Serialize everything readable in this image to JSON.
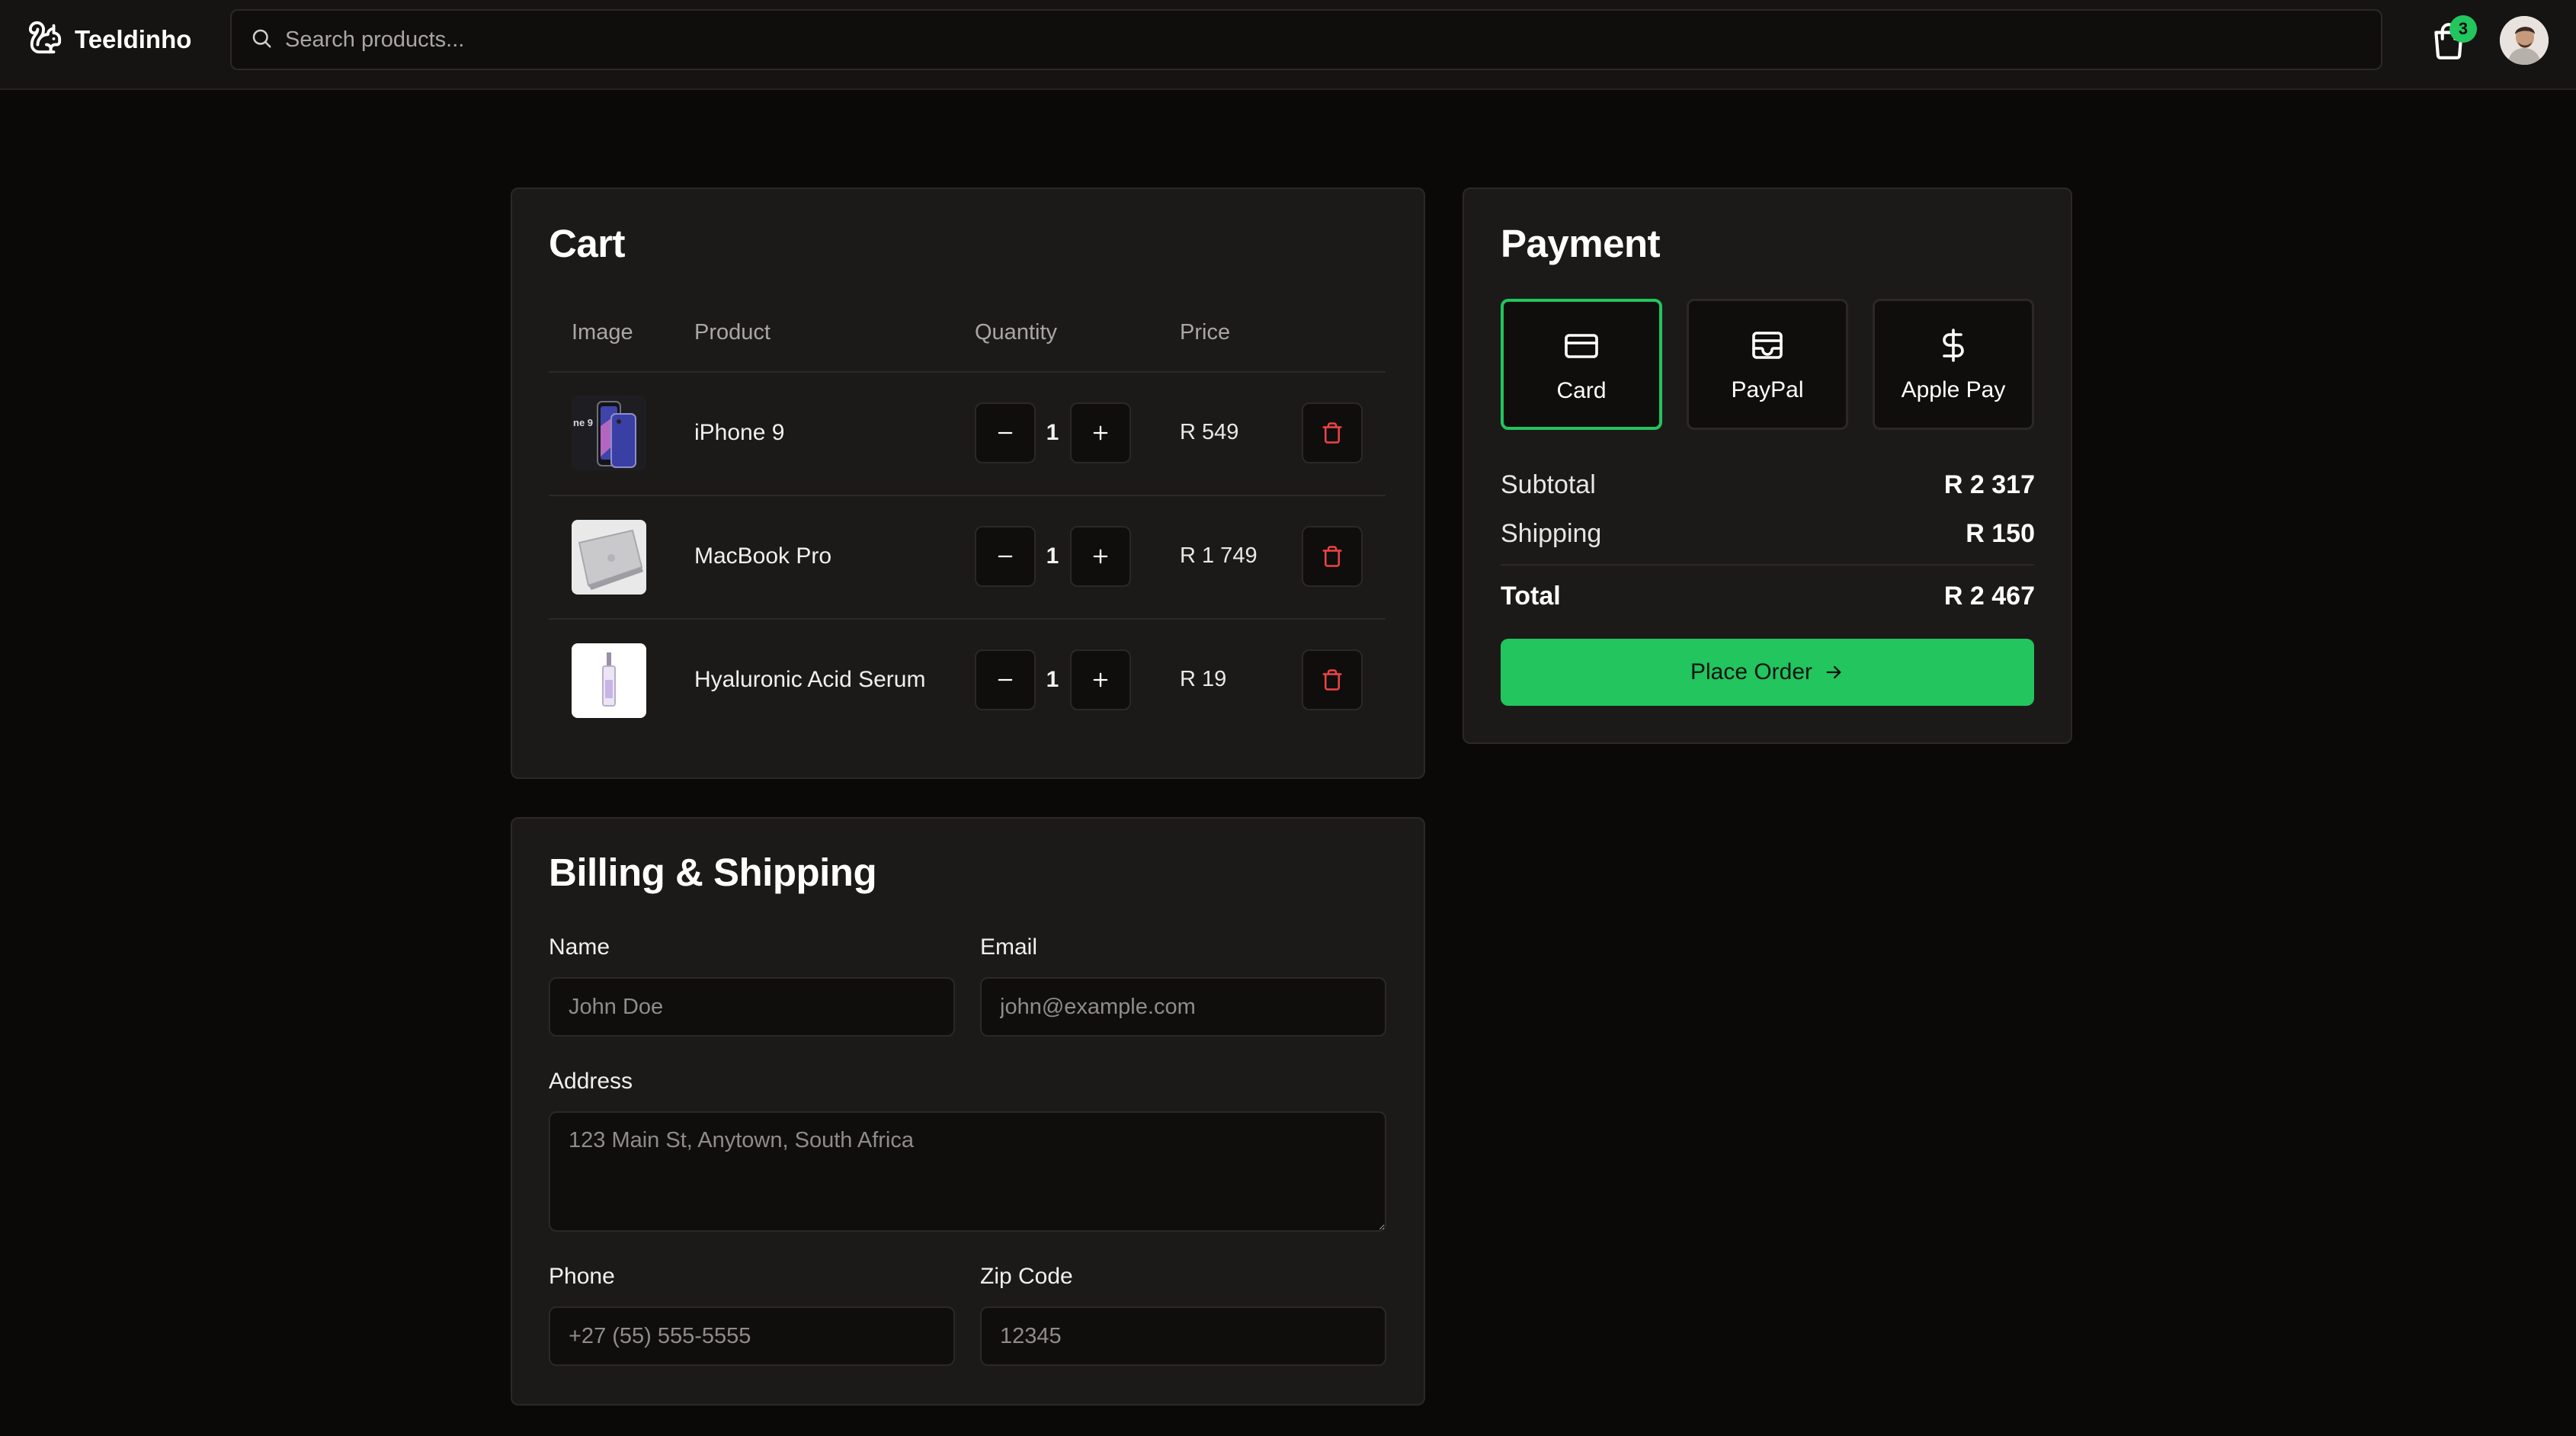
{
  "app": {
    "name": "Teeldinho"
  },
  "search": {
    "placeholder": "Search products..."
  },
  "header": {
    "cart_count": "3"
  },
  "cart": {
    "title": "Cart",
    "columns": [
      "Image",
      "Product",
      "Quantity",
      "Price"
    ],
    "items": [
      {
        "name": "iPhone 9",
        "quantity": "1",
        "price": "R 549"
      },
      {
        "name": "MacBook Pro",
        "quantity": "1",
        "price": "R 1 749"
      },
      {
        "name": "Hyaluronic Acid Serum",
        "quantity": "1",
        "price": "R 19"
      }
    ]
  },
  "billing": {
    "title": "Billing & Shipping",
    "name_label": "Name",
    "name_placeholder": "John Doe",
    "email_label": "Email",
    "email_placeholder": "john@example.com",
    "address_label": "Address",
    "address_placeholder": "123 Main St, Anytown, South Africa",
    "phone_label": "Phone",
    "phone_placeholder": "+27 (55) 555-5555",
    "zip_label": "Zip Code",
    "zip_placeholder": "12345"
  },
  "payment": {
    "title": "Payment",
    "methods": [
      {
        "label": "Card",
        "icon": "credit-card-icon",
        "selected": true
      },
      {
        "label": "PayPal",
        "icon": "wallet-icon",
        "selected": false
      },
      {
        "label": "Apple Pay",
        "icon": "dollar-icon",
        "selected": false
      }
    ],
    "subtotal_label": "Subtotal",
    "subtotal": "R 2 317",
    "shipping_label": "Shipping",
    "shipping": "R 150",
    "total_label": "Total",
    "total": "R 2 467",
    "place_order_label": "Place Order"
  },
  "colors": {
    "accent": "#22c55e",
    "danger": "#ef4444",
    "background": "#0a0908",
    "panel": "#1c1a18",
    "border": "#2b2826"
  }
}
